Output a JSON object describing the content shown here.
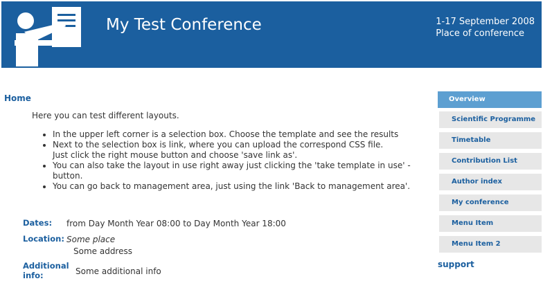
{
  "header": {
    "title": "My Test Conference",
    "date": "1-17 September 2008",
    "place": "Place of conference",
    "logo_icon": "presenter-icon",
    "background": "#1b5f9f"
  },
  "main": {
    "home_label": "Home",
    "intro": "Here you can test different layouts.",
    "bullets": [
      {
        "line1": "In the upper left corner is a selection box. Choose the template and see the results",
        "line2": ""
      },
      {
        "line1": "Next to the selection box is link, where you can upload the correspond CSS file.",
        "line2": "Just click the right mouse button and choose 'save link as'."
      },
      {
        "line1": "You can also take the layout in use right away just clicking the 'take template in use' - button.",
        "line2": ""
      },
      {
        "line1": "You can go back to management area, just using the link 'Back to management area'.",
        "line2": ""
      }
    ]
  },
  "details": {
    "dates_label": "Dates:",
    "dates_value": "from Day Month Year 08:00 to Day Month Year 18:00",
    "location_label": "Location:",
    "location_name": "Some place",
    "location_address": "Some address",
    "additional_label_1": "Additional",
    "additional_label_2": "info:",
    "additional_value": "Some additional info"
  },
  "menu": {
    "items": [
      {
        "label": "Overview",
        "active": true
      },
      {
        "label": "Scientific Programme"
      },
      {
        "label": "Timetable"
      },
      {
        "label": "Contribution List"
      },
      {
        "label": "Author index"
      },
      {
        "label": "My conference"
      },
      {
        "label": "Menu Item"
      },
      {
        "label": "Menu Item 2"
      }
    ],
    "support_label": "support",
    "active_color": "#5d9fd1",
    "item_color": "#e7e7e7"
  }
}
